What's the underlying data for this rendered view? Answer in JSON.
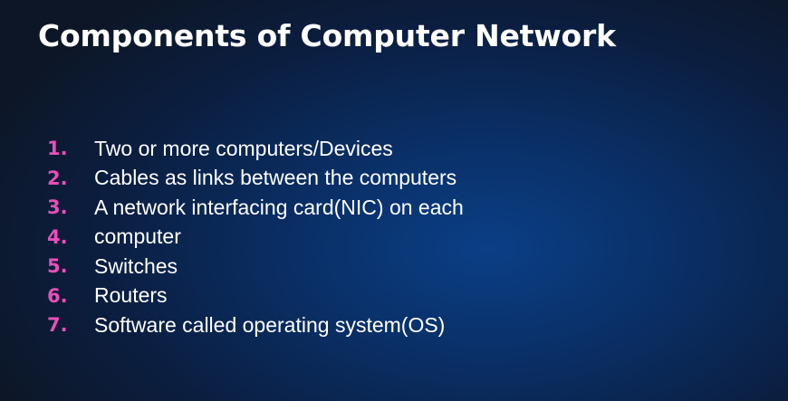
{
  "slide": {
    "title": "Components of Computer Network",
    "items": [
      {
        "number": "1.",
        "text": "Two or more computers/Devices"
      },
      {
        "number": "2.",
        "text": "Cables as links between the computers"
      },
      {
        "number": "3.",
        "text": "A network interfacing card(NIC) on each"
      },
      {
        "number": "4.",
        "text": "computer"
      },
      {
        "number": "5.",
        "text": "Switches"
      },
      {
        "number": "6.",
        "text": "Routers"
      },
      {
        "number": "7.",
        "text": "Software called operating system(OS)"
      }
    ]
  },
  "colors": {
    "number_accent": "#e94fb8",
    "text": "#ffffff",
    "background_center": "#0a3f86",
    "background_edge": "#0d1626"
  }
}
